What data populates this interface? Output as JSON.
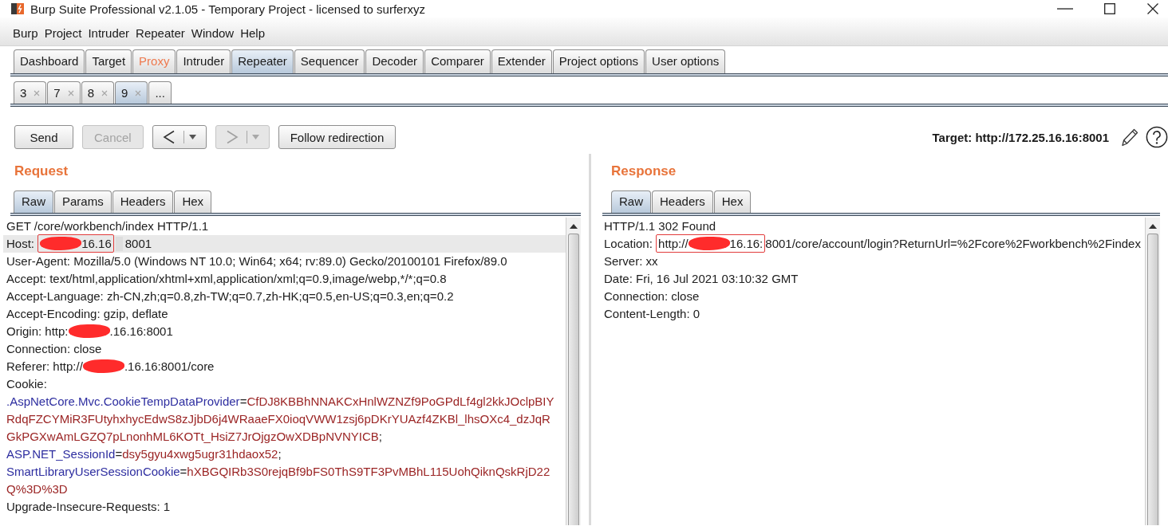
{
  "window": {
    "title": "Burp Suite Professional v2.1.05 - Temporary Project - licensed to surferxyz"
  },
  "menu": [
    "Burp",
    "Project",
    "Intruder",
    "Repeater",
    "Window",
    "Help"
  ],
  "tabs": [
    {
      "label": "Dashboard",
      "selected": false,
      "alert": false
    },
    {
      "label": "Target",
      "selected": false,
      "alert": false
    },
    {
      "label": "Proxy",
      "selected": false,
      "alert": true
    },
    {
      "label": "Intruder",
      "selected": false,
      "alert": false
    },
    {
      "label": "Repeater",
      "selected": true,
      "alert": false
    },
    {
      "label": "Sequencer",
      "selected": false,
      "alert": false
    },
    {
      "label": "Decoder",
      "selected": false,
      "alert": false
    },
    {
      "label": "Comparer",
      "selected": false,
      "alert": false
    },
    {
      "label": "Extender",
      "selected": false,
      "alert": false
    },
    {
      "label": "Project options",
      "selected": false,
      "alert": false
    },
    {
      "label": "User options",
      "selected": false,
      "alert": false
    }
  ],
  "repeater_tabs": [
    {
      "label": "3",
      "selected": false,
      "closable": true
    },
    {
      "label": "7",
      "selected": false,
      "closable": true
    },
    {
      "label": "8",
      "selected": false,
      "closable": true
    },
    {
      "label": "9",
      "selected": true,
      "closable": true
    },
    {
      "label": "...",
      "selected": false,
      "closable": false
    }
  ],
  "toolbar": {
    "buttons": [
      {
        "kind": "text",
        "label": "Send",
        "disabled": false
      },
      {
        "kind": "text",
        "label": "Cancel",
        "disabled": true
      },
      {
        "kind": "back",
        "disabled": false
      },
      {
        "kind": "forward",
        "disabled": true
      },
      {
        "kind": "text",
        "label": "Follow redirection",
        "disabled": false
      }
    ],
    "target": "Target: http://172.25.16.16:8001"
  },
  "request": {
    "title": "Request",
    "tabs": [
      {
        "label": "Raw",
        "selected": true
      },
      {
        "label": "Params",
        "selected": false
      },
      {
        "label": "Headers",
        "selected": false
      },
      {
        "label": "Hex",
        "selected": false
      }
    ],
    "lines": [
      {
        "current": false,
        "parts": [
          {
            "kind": "text",
            "text": "GET /core/workbench/index HTTP/1.1"
          }
        ]
      },
      {
        "current": true,
        "parts": [
          {
            "kind": "text",
            "text": "Host: "
          },
          {
            "kind": "boxed",
            "parts": [
              {
                "kind": "redaction"
              },
              {
                "kind": "text",
                "text": "16.16"
              }
            ]
          },
          {
            "kind": "blur"
          },
          {
            "kind": "text",
            "text": "8001"
          }
        ]
      },
      {
        "current": false,
        "parts": [
          {
            "kind": "text",
            "text": "User-Agent: Mozilla/5.0 (Windows NT 10.0; Win64; x64; rv:89.0) Gecko/20100101 Firefox/89.0"
          }
        ]
      },
      {
        "current": false,
        "parts": [
          {
            "kind": "text",
            "text": "Accept: text/html,application/xhtml+xml,application/xml;q=0.9,image/webp,*/*;q=0.8"
          }
        ]
      },
      {
        "current": false,
        "parts": [
          {
            "kind": "text",
            "text": "Accept-Language: zh-CN,zh;q=0.8,zh-TW;q=0.7,zh-HK;q=0.5,en-US;q=0.3,en;q=0.2"
          }
        ]
      },
      {
        "current": false,
        "parts": [
          {
            "kind": "text",
            "text": "Accept-Encoding: gzip, deflate"
          }
        ]
      },
      {
        "current": false,
        "parts": [
          {
            "kind": "text",
            "text": "Origin: http:"
          },
          {
            "kind": "redaction"
          },
          {
            "kind": "text",
            "text": ".16.16:8001"
          }
        ]
      },
      {
        "current": false,
        "parts": [
          {
            "kind": "text",
            "text": "Connection: close"
          }
        ]
      },
      {
        "current": false,
        "parts": [
          {
            "kind": "text",
            "text": "Referer: http://"
          },
          {
            "kind": "redaction"
          },
          {
            "kind": "text",
            "text": ".16.16:8001/core"
          }
        ]
      },
      {
        "current": false,
        "parts": [
          {
            "kind": "text",
            "text": "Cookie:"
          }
        ]
      },
      {
        "current": false,
        "parts": [
          {
            "kind": "name",
            "text": ".AspNetCore.Mvc.CookieTempDataProvider"
          },
          {
            "kind": "text",
            "text": "="
          },
          {
            "kind": "value",
            "text": "CfDJ8KBBhNNAKCxHnlWZNZf9PoGPdLf4gl2kkJOclpBIY"
          }
        ]
      },
      {
        "current": false,
        "parts": [
          {
            "kind": "value",
            "text": "RdqFZCYMiR3FUtyhxhycEdwS8zJjbD6j4WRaaeFX0ioqVWW1zsj6pDKrYUAzf4ZKBl_lhsOXc4_dzJqR"
          }
        ]
      },
      {
        "current": false,
        "parts": [
          {
            "kind": "value",
            "text": "GkPGXwAmLGZQ7pLnonhML6KOTt_HsiZ7JrOjgzOwXDBpNVNYICB"
          },
          {
            "kind": "text",
            "text": ";"
          }
        ]
      },
      {
        "current": false,
        "parts": [
          {
            "kind": "name",
            "text": "ASP.NET_SessionId"
          },
          {
            "kind": "text",
            "text": "="
          },
          {
            "kind": "value",
            "text": "dsy5gyu4xwg5ugr31hdaox52"
          },
          {
            "kind": "text",
            "text": ";"
          }
        ]
      },
      {
        "current": false,
        "parts": [
          {
            "kind": "name",
            "text": "SmartLibraryUserSessionCookie"
          },
          {
            "kind": "text",
            "text": "="
          },
          {
            "kind": "value",
            "text": "hXBGQIRb3S0rejqBf9bFS0ThS9TF3PvMBhL115UohQiknQskRjD22"
          }
        ]
      },
      {
        "current": false,
        "parts": [
          {
            "kind": "value",
            "text": "Q%3D%3D"
          }
        ]
      },
      {
        "current": false,
        "parts": [
          {
            "kind": "text",
            "text": "Upgrade-Insecure-Requests: 1"
          }
        ]
      }
    ]
  },
  "response": {
    "title": "Response",
    "tabs": [
      {
        "label": "Raw",
        "selected": true
      },
      {
        "label": "Headers",
        "selected": false
      },
      {
        "label": "Hex",
        "selected": false
      }
    ],
    "lines": [
      {
        "current": false,
        "parts": [
          {
            "kind": "text",
            "text": "HTTP/1.1 302 Found"
          }
        ]
      },
      {
        "current": false,
        "parts": [
          {
            "kind": "text",
            "text": "Location: "
          },
          {
            "kind": "boxed",
            "parts": [
              {
                "kind": "text",
                "text": "http://"
              },
              {
                "kind": "redaction"
              },
              {
                "kind": "text",
                "text": "16.16:"
              }
            ]
          },
          {
            "kind": "text",
            "text": "8001/core/account/login?ReturnUrl=%2Fcore%2Fworkbench%2Findex"
          }
        ]
      },
      {
        "current": false,
        "parts": [
          {
            "kind": "text",
            "text": "Server: xx"
          }
        ]
      },
      {
        "current": false,
        "parts": [
          {
            "kind": "text",
            "text": "Date: Fri, 16 Jul 2021 03:10:32 GMT"
          }
        ]
      },
      {
        "current": false,
        "parts": [
          {
            "kind": "text",
            "text": "Connection: close"
          }
        ]
      },
      {
        "current": false,
        "parts": [
          {
            "kind": "text",
            "text": "Content-Length: 0"
          }
        ]
      }
    ]
  }
}
